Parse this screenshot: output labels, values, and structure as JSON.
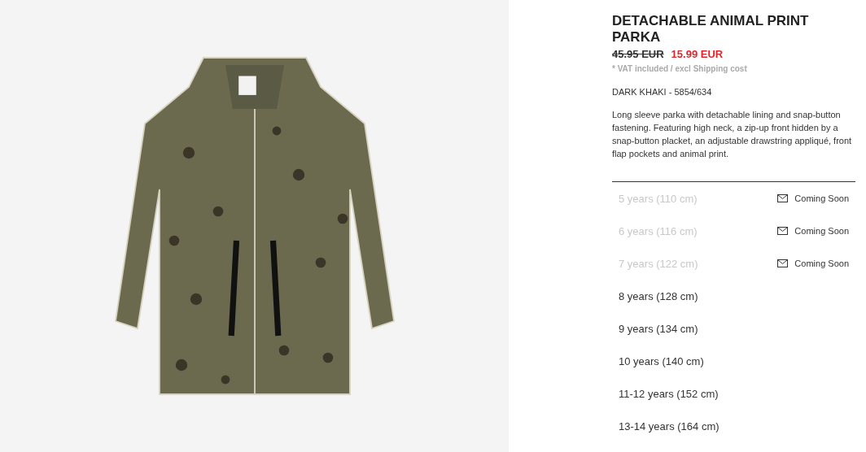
{
  "product": {
    "title": "DETACHABLE ANIMAL PRINT PARKA",
    "old_price": "45.95 EUR",
    "price": "15.99 EUR",
    "tax_note": "* VAT included / excl Shipping cost",
    "color_ref": "DARK KHAKI - 5854/634",
    "description": "Long sleeve parka with detachable lining and snap-button fastening. Featuring high neck, a zip-up front hidden by a snap-button placket, an adjustable drawstring appliqué, front flap pockets and animal print."
  },
  "sizes": [
    {
      "label": "5 years (110 cm)",
      "available": false,
      "notice": "Coming Soon"
    },
    {
      "label": "6 years (116 cm)",
      "available": false,
      "notice": "Coming Soon"
    },
    {
      "label": "7 years (122 cm)",
      "available": false,
      "notice": "Coming Soon"
    },
    {
      "label": "8 years (128 cm)",
      "available": true
    },
    {
      "label": "9 years (134 cm)",
      "available": true
    },
    {
      "label": "10 years (140 cm)",
      "available": true
    },
    {
      "label": "11-12 years (152 cm)",
      "available": true
    },
    {
      "label": "13-14 years (164 cm)",
      "available": true
    }
  ]
}
